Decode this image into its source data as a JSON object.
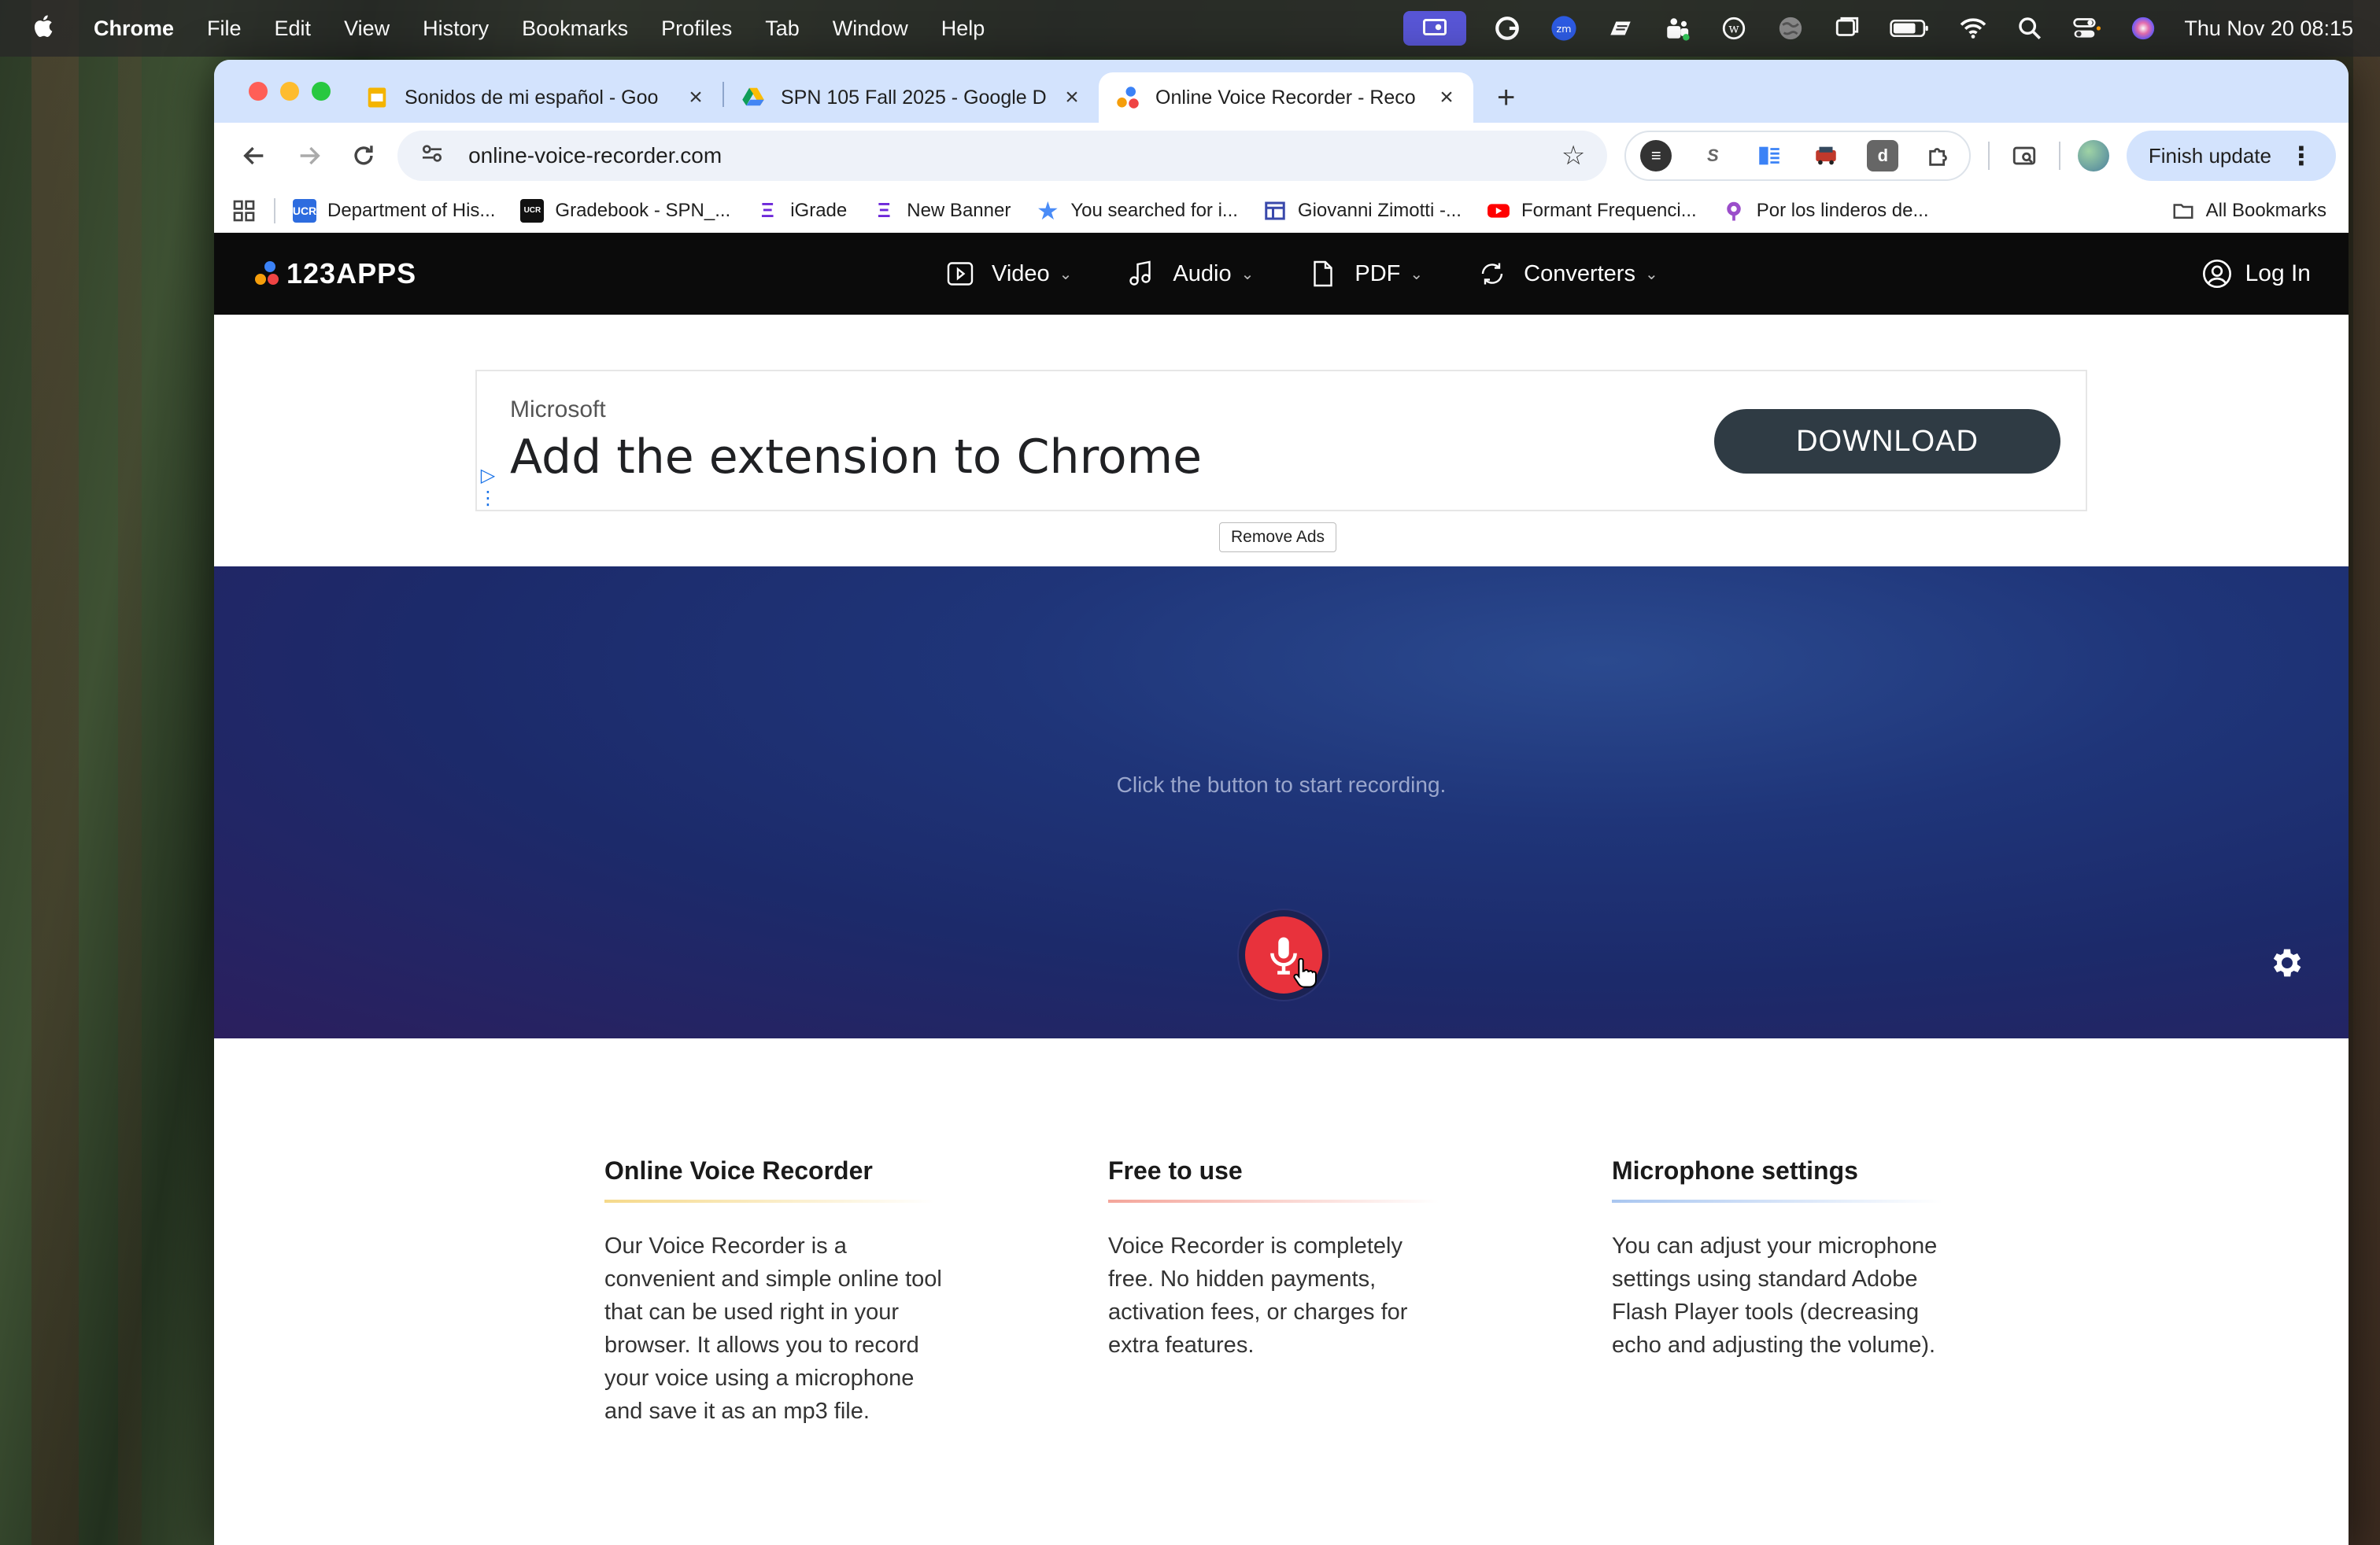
{
  "menubar": {
    "app": "Chrome",
    "items": [
      "File",
      "Edit",
      "View",
      "History",
      "Bookmarks",
      "Profiles",
      "Tab",
      "Window",
      "Help"
    ],
    "clock": "Thu Nov 20  08:15",
    "tray_icons": [
      "screen-share-icon",
      "grammarly-icon",
      "zoom-icon",
      "gmail-icon",
      "teams-icon",
      "wikipedia-icon",
      "globe-icon",
      "window-icon",
      "battery-icon",
      "wifi-icon",
      "search-icon",
      "control-center-icon",
      "siri-icon"
    ]
  },
  "tabs": [
    {
      "title": "Sonidos de mi español - Goo",
      "favicon": "slides-icon",
      "active": false
    },
    {
      "title": "SPN 105 Fall 2025 - Google D",
      "favicon": "drive-icon",
      "active": false
    },
    {
      "title": "Online Voice Recorder - Reco",
      "favicon": "123apps-icon",
      "active": true
    }
  ],
  "address": {
    "url": "online-voice-recorder.com"
  },
  "toolbar": {
    "finish_update": "Finish update"
  },
  "bookmarks": [
    {
      "label": "Department of His...",
      "icon": "ucr-icon"
    },
    {
      "label": "Gradebook - SPN_...",
      "icon": "ucr-learn-icon"
    },
    {
      "label": "iGrade",
      "icon": "igrade-icon"
    },
    {
      "label": "New Banner",
      "icon": "banner-icon"
    },
    {
      "label": "You searched for i...",
      "icon": "star-icon"
    },
    {
      "label": "Giovanni Zimotti -...",
      "icon": "site-icon"
    },
    {
      "label": "Formant Frequenci...",
      "icon": "youtube-icon"
    },
    {
      "label": "Por los linderos de...",
      "icon": "podcast-icon"
    }
  ],
  "all_bookmarks": "All Bookmarks",
  "site": {
    "logo": "123APPS",
    "nav": [
      {
        "label": "Video",
        "icon": "video-icon"
      },
      {
        "label": "Audio",
        "icon": "audio-icon"
      },
      {
        "label": "PDF",
        "icon": "pdf-icon"
      },
      {
        "label": "Converters",
        "icon": "converters-icon"
      }
    ],
    "login": "Log In"
  },
  "ad": {
    "brand": "Microsoft",
    "headline": "Add the extension to Chrome",
    "cta": "DOWNLOAD",
    "remove": "Remove Ads"
  },
  "recorder": {
    "hint": "Click the button to start recording."
  },
  "features": [
    {
      "title": "Online Voice Recorder",
      "body": "Our Voice Recorder is a convenient and simple online tool that can be used right in your browser. It allows you to record your voice using a microphone and save it as an mp3 file.",
      "accent": "#f5d98a"
    },
    {
      "title": "Free to use",
      "body": "Voice Recorder is completely free. No hidden payments, activation fees, or charges for extra features.",
      "accent": "#f4a59a"
    },
    {
      "title": "Microphone settings",
      "body": "You can adjust your microphone settings using standard Adobe Flash Player tools (decreasing echo and adjusting the volume).",
      "accent": "#a9c6f0"
    }
  ],
  "colors": {
    "record_button": "#e8323c",
    "recorder_bg": "#1f3579",
    "header_bg": "#0b0b0b",
    "tabstrip": "#d3e3fd"
  }
}
